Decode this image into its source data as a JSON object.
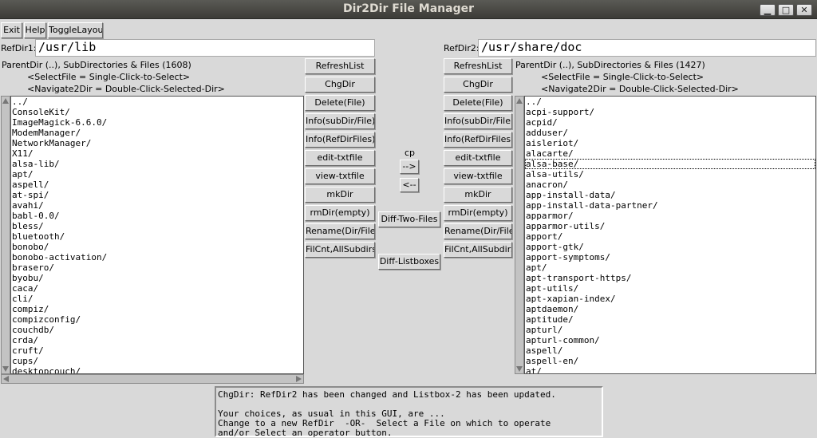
{
  "window": {
    "title": "Dir2Dir File Manager",
    "minimize": "▁",
    "maximize": "□",
    "close": "✕"
  },
  "toolbar": {
    "exit": "Exit",
    "help": "Help",
    "toggle": "ToggleLayout"
  },
  "left": {
    "ref_label": "RefDir1:",
    "ref_value": "/usr/lib",
    "header": "ParentDir (..), SubDirectories & Files (1608)",
    "hint1": "<SelectFile = Single-Click-to-Select>",
    "hint2": "<Navigate2Dir = Double-Click-Selected-Dir>",
    "items": [
      "../",
      "ConsoleKit/",
      "ImageMagick-6.6.0/",
      "ModemManager/",
      "NetworkManager/",
      "X11/",
      "alsa-lib/",
      "apt/",
      "aspell/",
      "at-spi/",
      "avahi/",
      "babl-0.0/",
      "bless/",
      "bluetooth/",
      "bonobo/",
      "bonobo-activation/",
      "brasero/",
      "byobu/",
      "caca/",
      "cli/",
      "compiz/",
      "compizconfig/",
      "couchdb/",
      "crda/",
      "cruft/",
      "cups/",
      "desktopcouch/"
    ]
  },
  "right": {
    "ref_label": "RefDir2:",
    "ref_value": "/usr/share/doc",
    "header": "ParentDir (..), SubDirectories & Files (1427)",
    "hint1": "<SelectFile = Single-Click-to-Select>",
    "hint2": "<Navigate2Dir = Double-Click-Selected-Dir>",
    "selected_index": 6,
    "items": [
      "../",
      "acpi-support/",
      "acpid/",
      "adduser/",
      "aisleriot/",
      "alacarte/",
      "alsa-base/",
      "alsa-utils/",
      "anacron/",
      "app-install-data/",
      "app-install-data-partner/",
      "apparmor/",
      "apparmor-utils/",
      "apport/",
      "apport-gtk/",
      "apport-symptoms/",
      "apt/",
      "apt-transport-https/",
      "apt-utils/",
      "apt-xapian-index/",
      "aptdaemon/",
      "aptitude/",
      "apturl/",
      "apturl-common/",
      "aspell/",
      "aspell-en/",
      "at/"
    ]
  },
  "buttons": [
    "RefreshList",
    "ChgDir",
    "Delete(File)",
    "Info(subDir/File)",
    "Info(RefDirFiles)",
    "edit-txtfile",
    "view-txtfile",
    "mkDir",
    "rmDir(empty)",
    "Rename(Dir/File)",
    "FilCnt,AllSubdirs"
  ],
  "middle": {
    "cp_label": "cp",
    "copy_right": "-->",
    "copy_left": "<--",
    "diff_files": "Diff-Two-Files",
    "diff_lists": "Diff-Listboxes"
  },
  "message": [
    "ChgDir: RefDir2 has been changed and Listbox-2 has been updated.",
    "",
    "Your choices, as usual in this GUI, are ...",
    "Change to a new RefDir  -OR-  Select a File on which to operate",
    "and/or Select an operator button."
  ]
}
